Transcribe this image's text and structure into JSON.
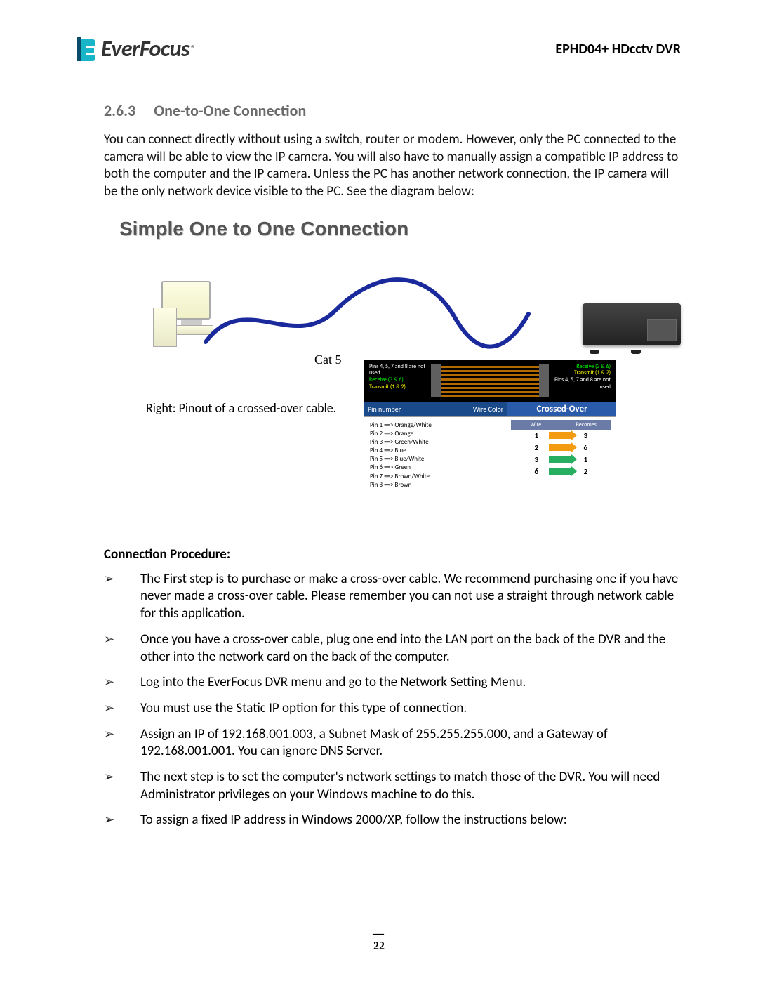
{
  "header": {
    "brand": "EverFocus",
    "registered": "®",
    "doc_title": "EPHD04+  HDcctv DVR"
  },
  "section": {
    "number": "2.6.3",
    "title": "One-to-One Connection",
    "body": "You can connect directly without using a switch, router or modem. However, only the PC connected to the camera will be able to view the IP camera. You will also have to manually assign a compatible IP address to both the computer and the IP camera. Unless the PC has another network connection, the IP camera will be the only network device visible to the PC. See the diagram below:"
  },
  "diagram": {
    "title": "Simple One to One Connection",
    "cable_label": "Cat 5",
    "caption": "Right: Pinout of a crossed-over cable.",
    "pinout": {
      "top_left_note": "Pins 4, 5, 7 and 8 are not used",
      "top_right_note": "Pins 4, 5, 7 and 8 are not used",
      "rx_left": "Receive (3 & 6)",
      "tx_left": "Transmit (1 & 2)",
      "rx_right": "Receive (3 & 6)",
      "tx_right": "Transmit (1 & 2)",
      "header_left_a": "Pin number",
      "header_left_b": "Wire Color",
      "header_right": "Crossed-Over",
      "sub_wire": "Wire",
      "sub_becomes": "Becomes",
      "pins": [
        "Pin 1 ==> Orange/White",
        "Pin 2 ==> Orange",
        "Pin 3 ==> Green/White",
        "Pin 4 ==> Blue",
        "Pin 5 ==> Blue/White",
        "Pin 6 ==> Green",
        "Pin 7 ==> Brown/White",
        "Pin 8 ==> Brown"
      ],
      "mapping": [
        {
          "from": "1",
          "to": "3",
          "color": "orange"
        },
        {
          "from": "2",
          "to": "6",
          "color": "orange"
        },
        {
          "from": "3",
          "to": "1",
          "color": "green"
        },
        {
          "from": "6",
          "to": "2",
          "color": "green"
        }
      ]
    }
  },
  "procedure": {
    "heading": "Connection Procedure:",
    "items": [
      "The First step is to purchase or make a cross-over cable. We recommend purchasing one if you have never made a cross-over cable. Please remember you can not use a straight through network cable for this application.",
      "Once you have a cross-over cable, plug one end into the LAN port on the back of the DVR and the other into the network card on the back of the computer.",
      "Log into the EverFocus DVR menu and go to the Network Setting Menu.",
      "You must use the Static IP option for this type of connection.",
      "Assign an IP of 192.168.001.003, a Subnet Mask of 255.255.255.000, and a Gateway of 192.168.001.001. You can ignore DNS Server.",
      "The next step is to set the computer's network settings to match those of the DVR. You will need Administrator privileges on your Windows machine to do this.",
      "To assign a fixed IP address in Windows 2000/XP, follow the instructions below:"
    ]
  },
  "footer": {
    "page": "22"
  }
}
